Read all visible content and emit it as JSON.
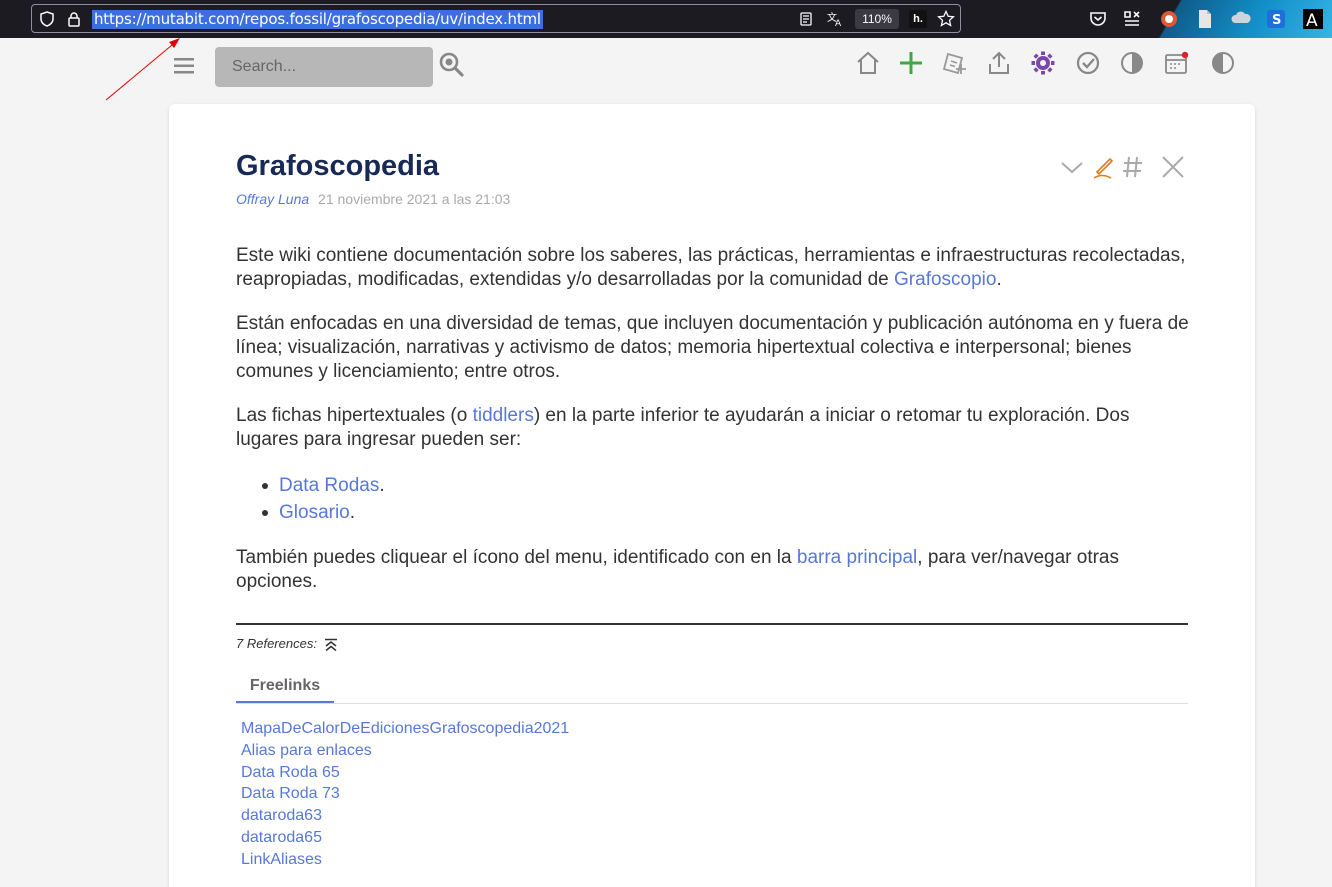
{
  "browser": {
    "url": "https://mutabit.com/repos.fossil/grafoscopedia/uv/index.html",
    "zoom": "110%",
    "hypothesis_badge": "h."
  },
  "toolbar": {
    "search_placeholder": "Search..."
  },
  "tiddler": {
    "title": "Grafoscopedia",
    "author": "Offray Luna",
    "date": "21 noviembre 2021 a las 21:03",
    "p1_text": "Este wiki contiene documentación sobre los saberes, las prácticas, herramientas e infraestructuras recolectadas, reapropiadas, modificadas, extendidas y/o desarrolladas por la comunidad de ",
    "p1_link": "Grafoscopio",
    "p1_end": ".",
    "p2_text": "Están enfocadas en una diversidad de temas, que incluyen documentación y publicación autónoma en y fuera de línea; visualización, narrativas y activismo de datos; memoria hipertextual colectiva e interpersonal; bienes comunes y licenciamiento; entre otros.",
    "p3_a": "Las fichas hipertextuales (o ",
    "p3_link": "tiddlers",
    "p3_b": ") en la parte inferior te ayudarán a iniciar o retomar tu exploración. Dos lugares para ingresar pueden ser:",
    "list": [
      {
        "link": "Data Rodas",
        "end": "."
      },
      {
        "link": "Glosario",
        "end": "."
      }
    ],
    "p4_a": "También puedes cliquear el ícono del menu, identificado con en la ",
    "p4_link": "barra principal",
    "p4_b": ", para ver/navegar otras opciones."
  },
  "references": {
    "label": "7 References:",
    "tab": "Freelinks",
    "links": [
      "MapaDeCalorDeEdicionesGrafoscopedia2021",
      "Alias para enlaces",
      "Data Roda 65",
      "Data Roda 73",
      "dataroda63",
      "dataroda65",
      "LinkAliases"
    ]
  },
  "colors": {
    "title": "#182955",
    "link": "#5778d8",
    "add_icon": "#3fa744",
    "gear_icon": "#7a48a8",
    "edit_icon": "#e07b1a"
  }
}
